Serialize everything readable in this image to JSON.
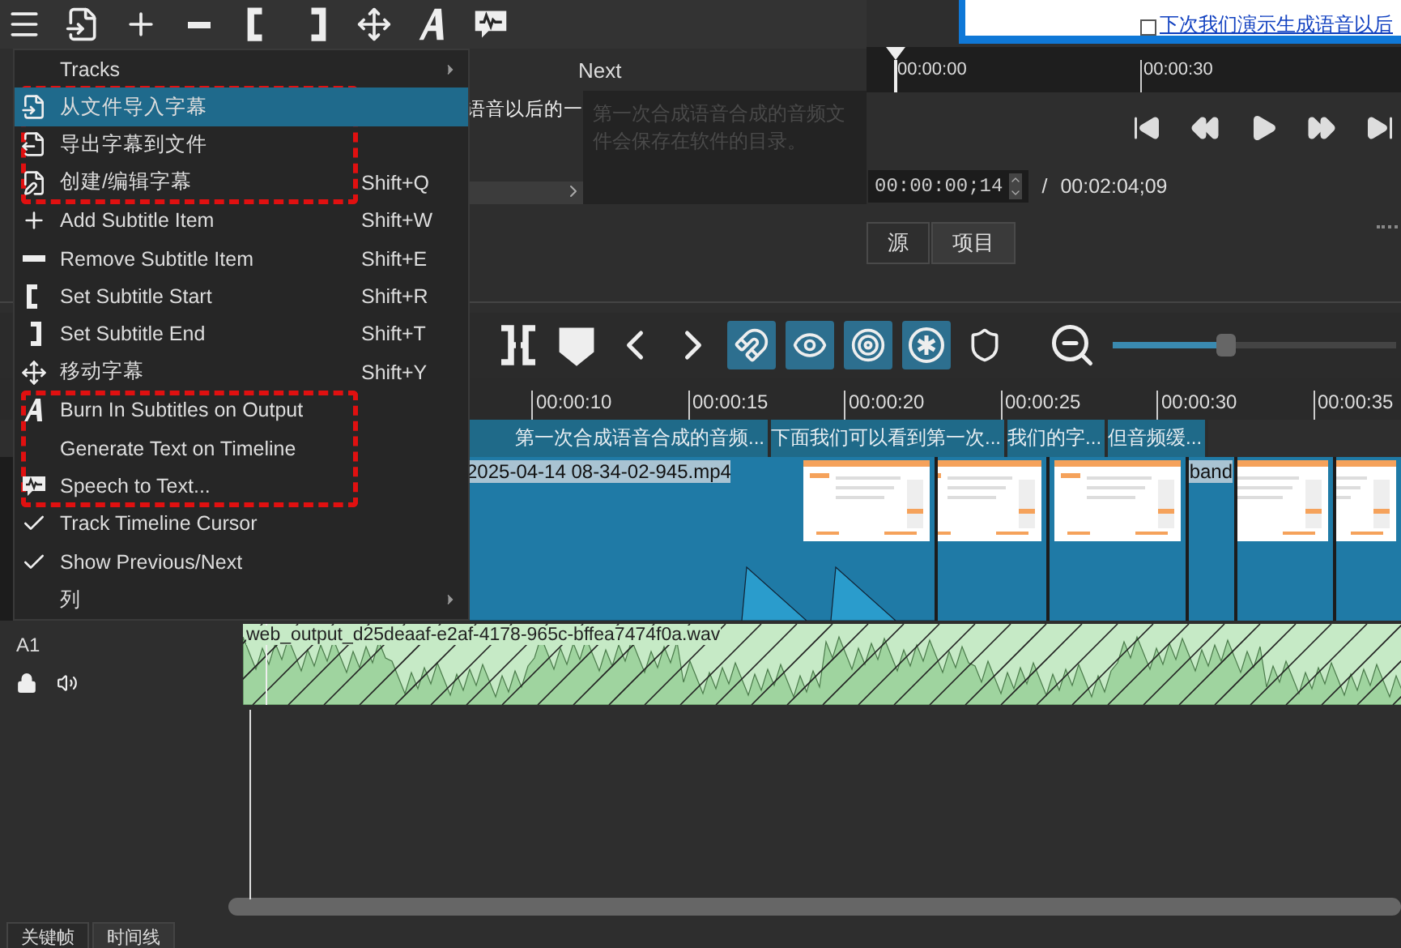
{
  "context_menu": {
    "sections": [
      {
        "highlighted": false,
        "items": [
          {
            "label": "Tracks",
            "kind": "submenu",
            "selected": false,
            "checked": false
          }
        ]
      },
      {
        "highlighted": true,
        "items": [
          {
            "label": "从文件导入字幕",
            "kind": "item",
            "selected": true,
            "checked": false
          },
          {
            "label": "导出字幕到文件",
            "kind": "item",
            "selected": false,
            "checked": false
          },
          {
            "label": "创建/编辑字幕",
            "kind": "item",
            "shortcut": "Shift+Q",
            "selected": false,
            "checked": false
          }
        ]
      },
      {
        "highlighted": false,
        "items": [
          {
            "label": "Add Subtitle Item",
            "kind": "item",
            "shortcut": "Shift+W",
            "selected": false,
            "checked": false
          },
          {
            "label": "Remove Subtitle Item",
            "kind": "item",
            "shortcut": "Shift+E",
            "selected": false,
            "checked": false
          },
          {
            "label": "Set Subtitle Start",
            "kind": "item",
            "shortcut": "Shift+R",
            "selected": false,
            "checked": false
          },
          {
            "label": "Set Subtitle End",
            "kind": "item",
            "shortcut": "Shift+T",
            "selected": false,
            "checked": false
          },
          {
            "label": "移动字幕",
            "kind": "item",
            "shortcut": "Shift+Y",
            "selected": false,
            "checked": false
          }
        ]
      },
      {
        "highlighted": true,
        "items": [
          {
            "label": "Burn In Subtitles on Output",
            "kind": "item",
            "selected": false,
            "checked": false
          },
          {
            "label": "Generate Text on Timeline",
            "kind": "item",
            "selected": false,
            "checked": false
          },
          {
            "label": "Speech to Text...",
            "kind": "item",
            "selected": false,
            "checked": false
          }
        ]
      },
      {
        "highlighted": false,
        "items": [
          {
            "label": "Track Timeline Cursor",
            "kind": "item",
            "selected": false,
            "checked": true
          },
          {
            "label": "Show Previous/Next",
            "kind": "item",
            "selected": false,
            "checked": true
          },
          {
            "label": "列",
            "kind": "submenu",
            "selected": false,
            "checked": false
          }
        ]
      }
    ]
  },
  "subtitle_list": {
    "header": "Next",
    "current_text": "语音以后的一",
    "next_text": "第一次合成语音合成的音频文件会保存在软件的目录。"
  },
  "preview": {
    "text": "下次我们演示生成语音以后"
  },
  "player": {
    "ruler": [
      "00:00:00",
      "00:00:30"
    ],
    "timecode": "00:00:00;14",
    "separator": "/",
    "duration": "00:02:04;09",
    "tabs": [
      {
        "label": "源",
        "selected": false
      },
      {
        "label": "项目",
        "selected": true
      }
    ]
  },
  "timeline": {
    "toggles": [
      {
        "on": true
      },
      {
        "on": true
      },
      {
        "on": true
      },
      {
        "on": true
      },
      {
        "on": false
      }
    ],
    "zoom": {
      "level": 0.4
    },
    "ruler": [
      "00:00:10",
      "00:00:15",
      "00:00:20",
      "00:00:25",
      "00:00:30",
      "00:00:35"
    ],
    "subtitles": [
      {
        "text": "第一次合成语音合成的音频..."
      },
      {
        "text": "下面我们可以看到第一次..."
      },
      {
        "text": "我们的字..."
      },
      {
        "text": "但音频缓..."
      }
    ],
    "video_clips": [
      {
        "kind": "labeled",
        "label": "2025-04-14 08-34-02-945.mp4"
      },
      {
        "kind": "plain"
      },
      {
        "kind": "plain"
      },
      {
        "kind": "labeled",
        "label": "band"
      },
      {
        "kind": "plain"
      },
      {
        "kind": "plain"
      }
    ],
    "audio_track": {
      "name": "A1",
      "clip": "web_output_d25deaaf-e2af-4178-965c-bffea7474f0a.wav"
    }
  },
  "bottom_tabs": [
    {
      "label": "关键帧",
      "selected": false
    },
    {
      "label": "时间线",
      "selected": true
    }
  ]
}
